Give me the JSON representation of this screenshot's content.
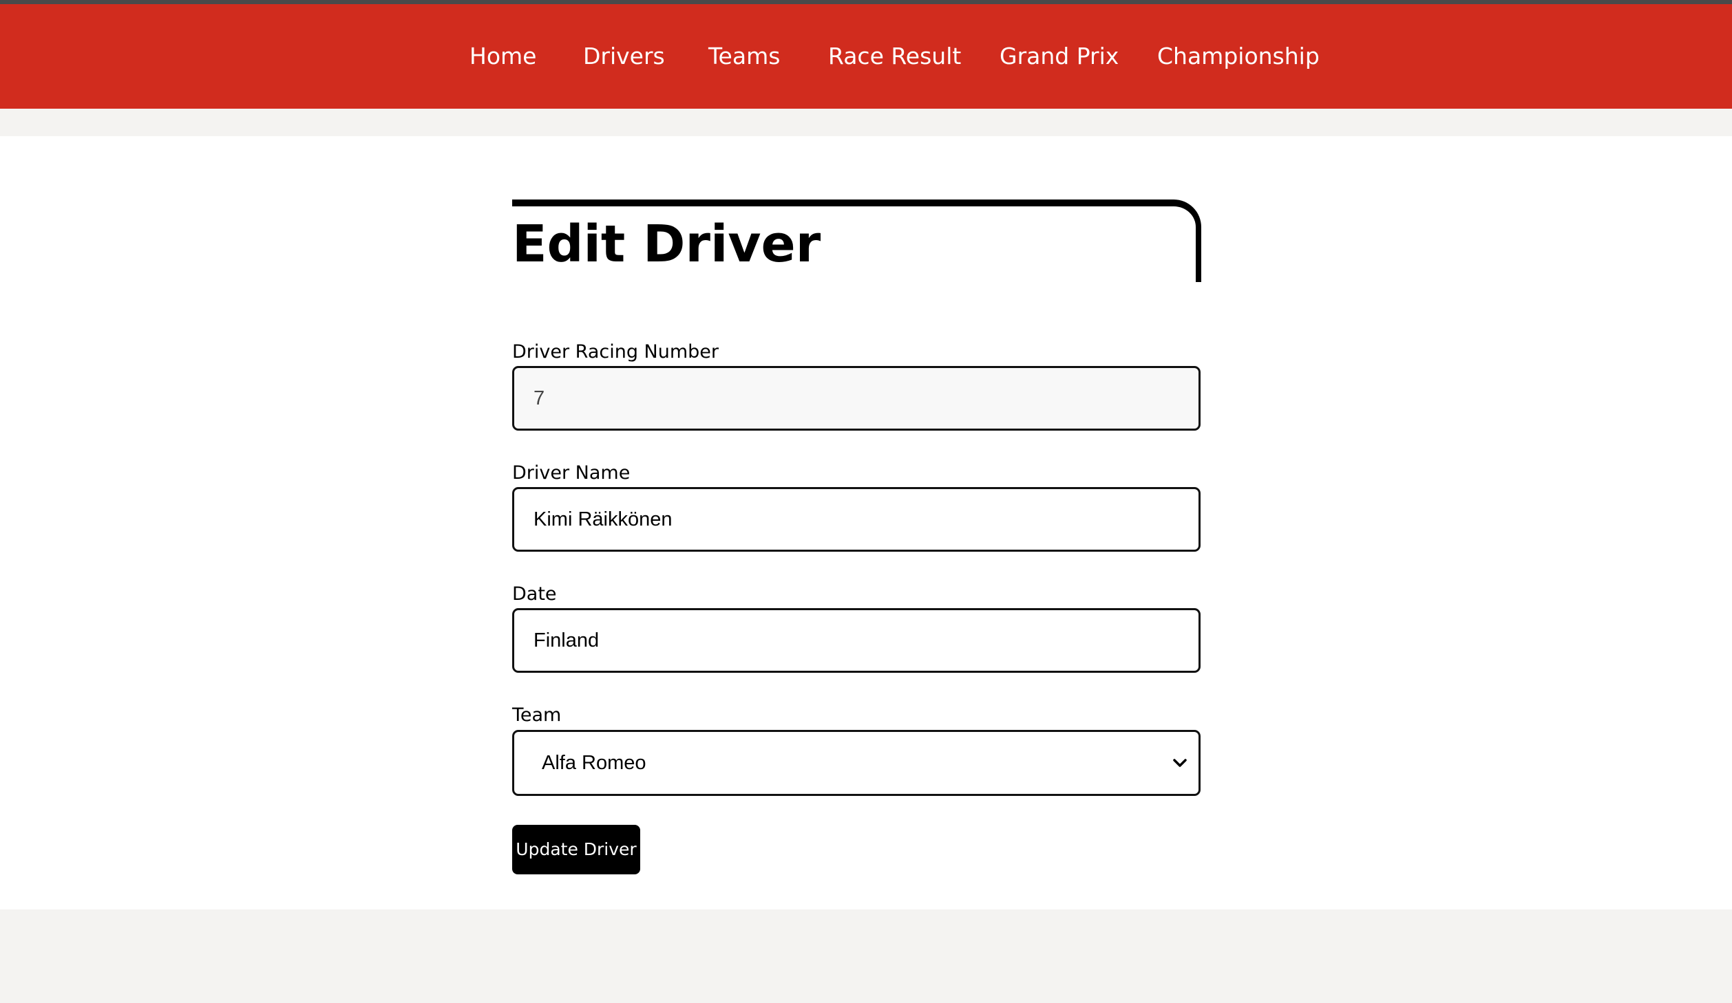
{
  "nav": {
    "items": [
      {
        "label": "Home"
      },
      {
        "label": "Drivers"
      },
      {
        "label": "Teams"
      },
      {
        "label": "Race Result"
      },
      {
        "label": "Grand Prix"
      },
      {
        "label": "Championship"
      }
    ]
  },
  "page": {
    "title": "Edit Driver"
  },
  "form": {
    "racing_number": {
      "label": "Driver Racing Number",
      "value": "7"
    },
    "driver_name": {
      "label": "Driver Name",
      "value": "Kimi Räikkönen"
    },
    "date": {
      "label": "Date",
      "value": "Finland"
    },
    "team": {
      "label": "Team",
      "selected": "Alfa Romeo"
    },
    "submit_label": "Update Driver"
  },
  "colors": {
    "nav_background": "#d12c1e",
    "page_background": "#f4f3f1",
    "panel_background": "#ffffff",
    "button_background": "#000000"
  },
  "icons": {
    "select_arrow": "chevron-down-icon"
  }
}
